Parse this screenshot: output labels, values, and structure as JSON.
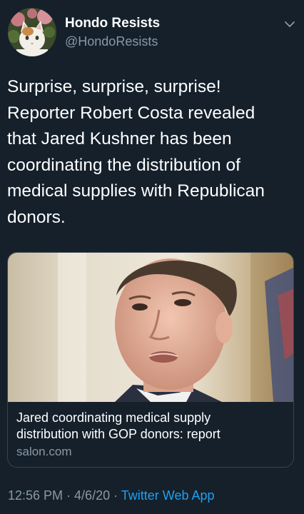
{
  "tweet": {
    "author": {
      "display_name": "Hondo Resists",
      "handle": "@HondoResists"
    },
    "text_lines": [
      "Surprise, surprise, surprise!",
      "Reporter Robert Costa revealed",
      "that Jared Kushner has been",
      "coordinating the distribution of",
      "medical supplies with Republican",
      "donors."
    ],
    "card": {
      "title_lines": [
        "Jared coordinating medical supply",
        "distribution with GOP donors: report"
      ],
      "domain": "salon.com"
    },
    "meta": {
      "time": "12:56 PM",
      "separator1": " · ",
      "date": "4/6/20",
      "separator2": " · ",
      "app": "Twitter Web App"
    }
  },
  "icons": {
    "menu": "chevron-down-icon",
    "avatar": "cat-avatar"
  },
  "colors": {
    "background": "#15202b",
    "text_primary": "#ffffff",
    "text_secondary": "#8899a6",
    "link": "#1da1f2",
    "card_border": "#38444d"
  }
}
